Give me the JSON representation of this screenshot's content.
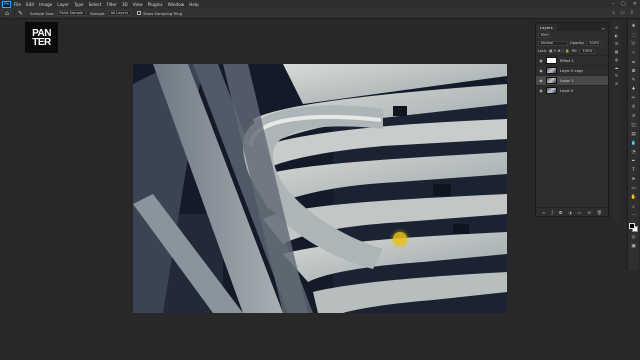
{
  "app": {
    "logo_text": "Ps"
  },
  "menu": [
    "File",
    "Edit",
    "Image",
    "Layer",
    "Type",
    "Select",
    "Filter",
    "3D",
    "View",
    "Plugins",
    "Window",
    "Help"
  ],
  "window_controls": [
    "–",
    "▢",
    "✕"
  ],
  "options_bar": {
    "sample_size_label": "Sample Size:",
    "sample_size_value": "Point Sample",
    "sample_label": "Sample:",
    "sample_value": "All Layers",
    "ring_label": "Show Sampling Ring"
  },
  "logo": {
    "line1": "PAN",
    "line2": "TER"
  },
  "layers_panel": {
    "tab": "Layers",
    "kind_filter": "Kind",
    "blend_mode": "Normal",
    "opacity_label": "Opacity:",
    "opacity_value": "100%",
    "lock_label": "Lock:",
    "fill_label": "Fill:",
    "fill_value": "100%",
    "layers": [
      {
        "name": "Effect 1",
        "selected": false,
        "thumb": "white"
      },
      {
        "name": "Layer 0 copy",
        "selected": false,
        "thumb": "photo"
      },
      {
        "name": "Layer 1",
        "selected": true,
        "thumb": "photo"
      },
      {
        "name": "Layer 0",
        "selected": false,
        "thumb": "photo"
      }
    ],
    "footer_icons": [
      "link-icon",
      "fx-icon",
      "mask-icon",
      "adjustment-icon",
      "group-icon",
      "new-layer-icon",
      "trash-icon"
    ]
  },
  "colors": {
    "accent": "#31a8ff",
    "cursor_highlight": "#e8c21a",
    "selected_layer": "#484848"
  }
}
